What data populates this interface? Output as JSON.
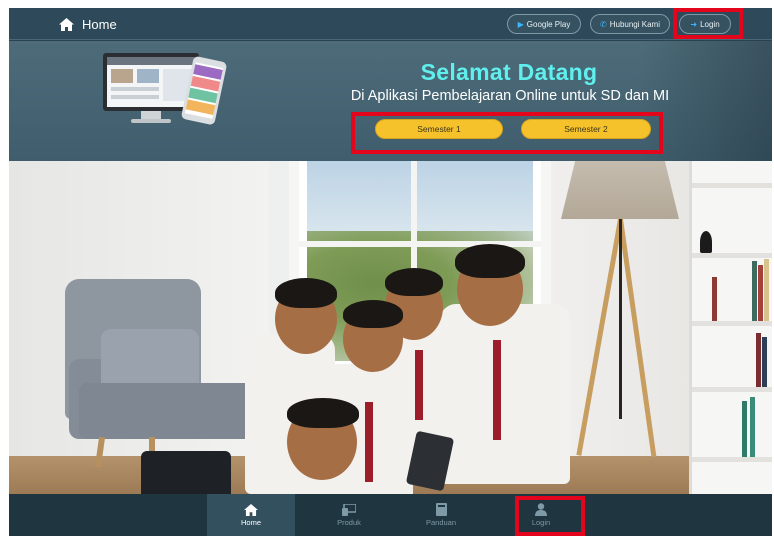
{
  "topbar": {
    "home_label": "Home",
    "google_play_label": "Google Play",
    "contact_label": "Hubungi Kami",
    "login_label": "Login",
    "icons": {
      "home": "home-icon",
      "google_play": "play-icon",
      "contact": "phone-icon",
      "login": "sign-in-icon"
    }
  },
  "hero": {
    "title": "Selamat Datang",
    "subtitle": "Di Aplikasi Pembelajaran Online untuk SD dan MI",
    "semester_buttons": [
      "Semester 1",
      "Semester 2"
    ]
  },
  "bottom_nav": {
    "items": [
      {
        "label": "Home",
        "icon": "home-icon",
        "active": true
      },
      {
        "label": "Produk",
        "icon": "product-icon",
        "active": false
      },
      {
        "label": "Panduan",
        "icon": "book-icon",
        "active": false
      },
      {
        "label": "Login",
        "icon": "user-icon",
        "active": false
      }
    ]
  },
  "colors": {
    "accent_title": "#5ff0ee",
    "button_yellow": "#f6c22c",
    "highlight_red": "#e3051b",
    "icon_blue": "#38b6ff",
    "nav_active": "#33505e"
  }
}
